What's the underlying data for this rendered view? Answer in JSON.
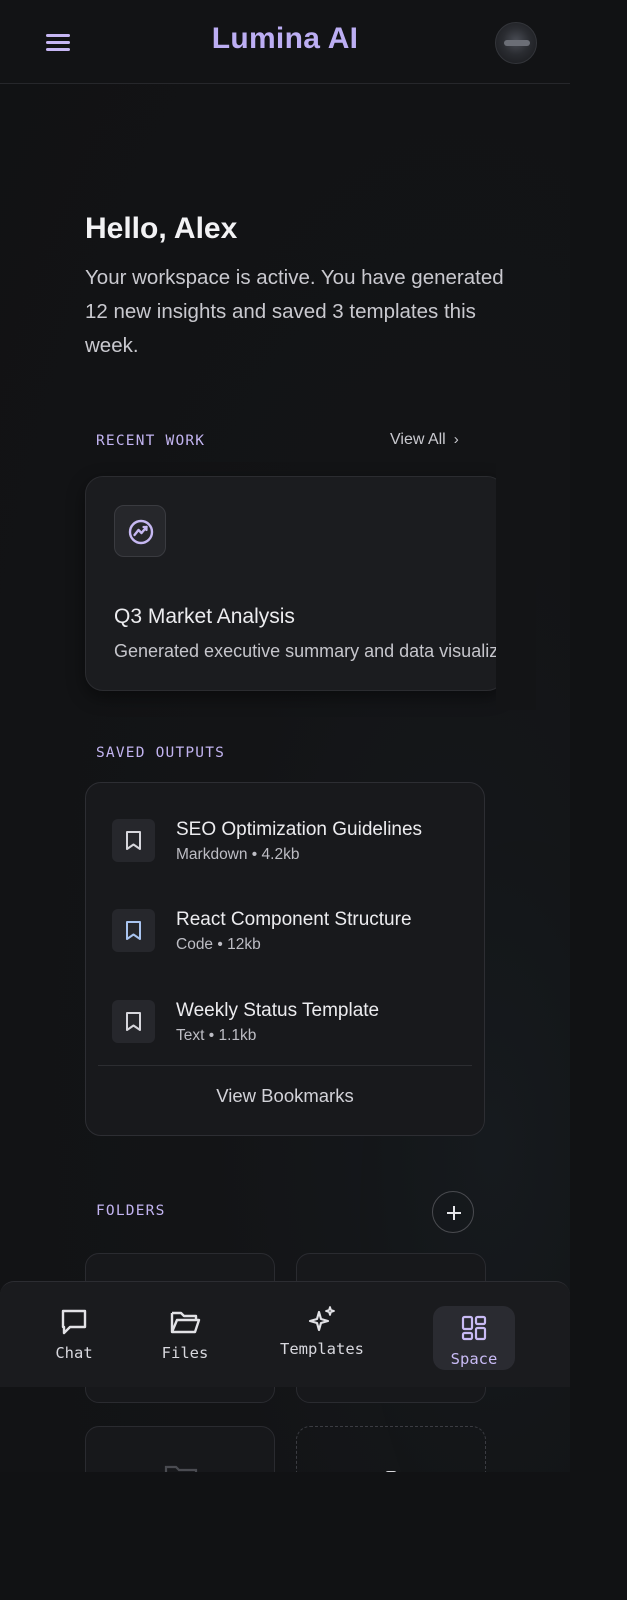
{
  "header": {
    "title": "Lumina AI"
  },
  "greeting": {
    "title": "Hello, Alex",
    "subtitle": "Your workspace is active. You have generated 12 new insights and saved 3 templates this week."
  },
  "recent": {
    "label": "RECENT WORK",
    "view_all": "View All",
    "card": {
      "title": "Q3 Market Analysis",
      "description": "Generated executive summary and data visualization"
    }
  },
  "saved": {
    "label": "SAVED OUTPUTS",
    "items": [
      {
        "title": "SEO Optimization Guidelines",
        "meta": "Markdown • 4.2kb"
      },
      {
        "title": "React Component Structure",
        "meta": "Code • 12kb"
      },
      {
        "title": "Weekly Status Template",
        "meta": "Text • 1.1kb"
      }
    ],
    "view_bookmarks": "View Bookmarks"
  },
  "folders": {
    "label": "FOLDERS"
  },
  "nav": {
    "items": [
      {
        "label": "Chat",
        "icon": "chat-icon"
      },
      {
        "label": "Files",
        "icon": "folder-icon"
      },
      {
        "label": "Templates",
        "icon": "sparkles-icon"
      },
      {
        "label": "Space",
        "icon": "dashboard-icon",
        "active": true
      }
    ]
  },
  "colors": {
    "accent": "#c2b4f0",
    "background": "#111214",
    "card": "#1b1c1f"
  }
}
